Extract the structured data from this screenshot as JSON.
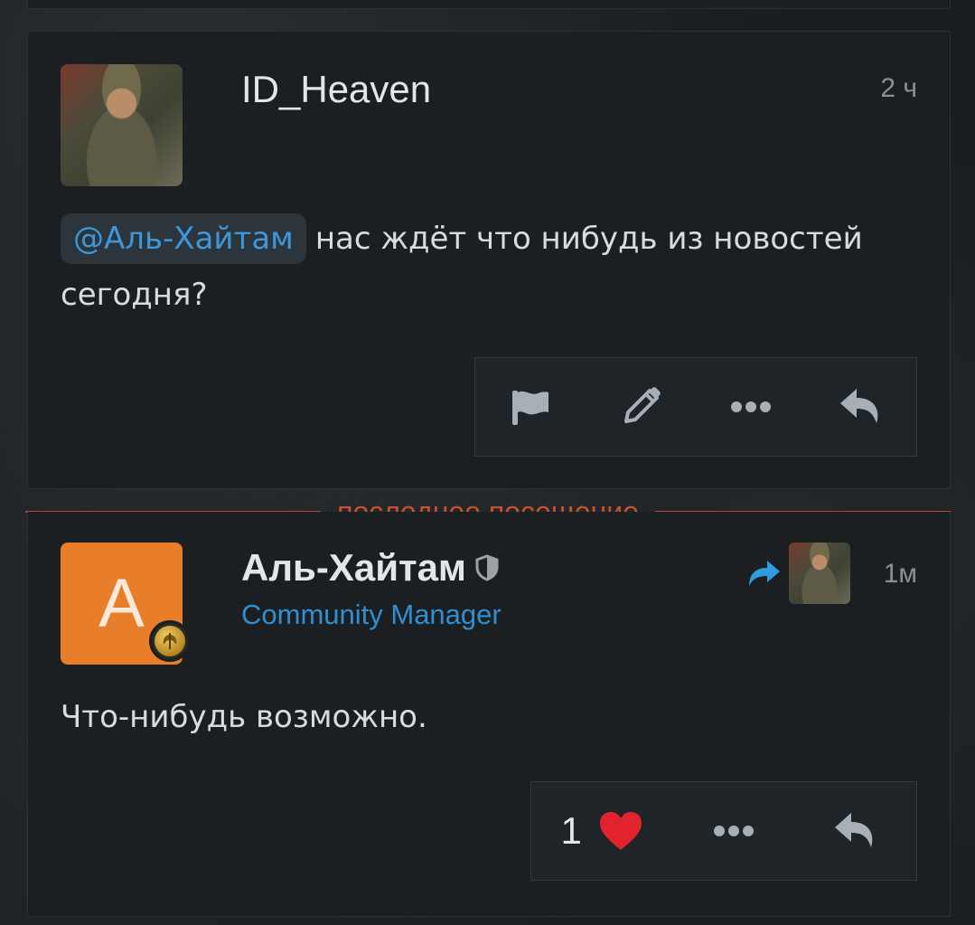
{
  "post1": {
    "author": "ID_Heaven",
    "time": "2 ч",
    "mention": "@Аль-Хайтам",
    "text": "нас ждёт что нибудь из новостей сегодня?",
    "actions": [
      "flag-icon",
      "edit-icon",
      "more-icon",
      "reply-icon"
    ]
  },
  "divider": {
    "label": "последнее посещение",
    "color": "#c6522f"
  },
  "post2": {
    "avatar_letter": "А",
    "avatar_color": "#e87e2a",
    "author": "Аль-Хайтам",
    "role": "Community Manager",
    "role_color": "#2f8fd0",
    "time": "1м",
    "text": "Что-нибудь возможно.",
    "like_count": "1",
    "actions": [
      "like-icon",
      "more-icon",
      "reply-icon"
    ]
  }
}
